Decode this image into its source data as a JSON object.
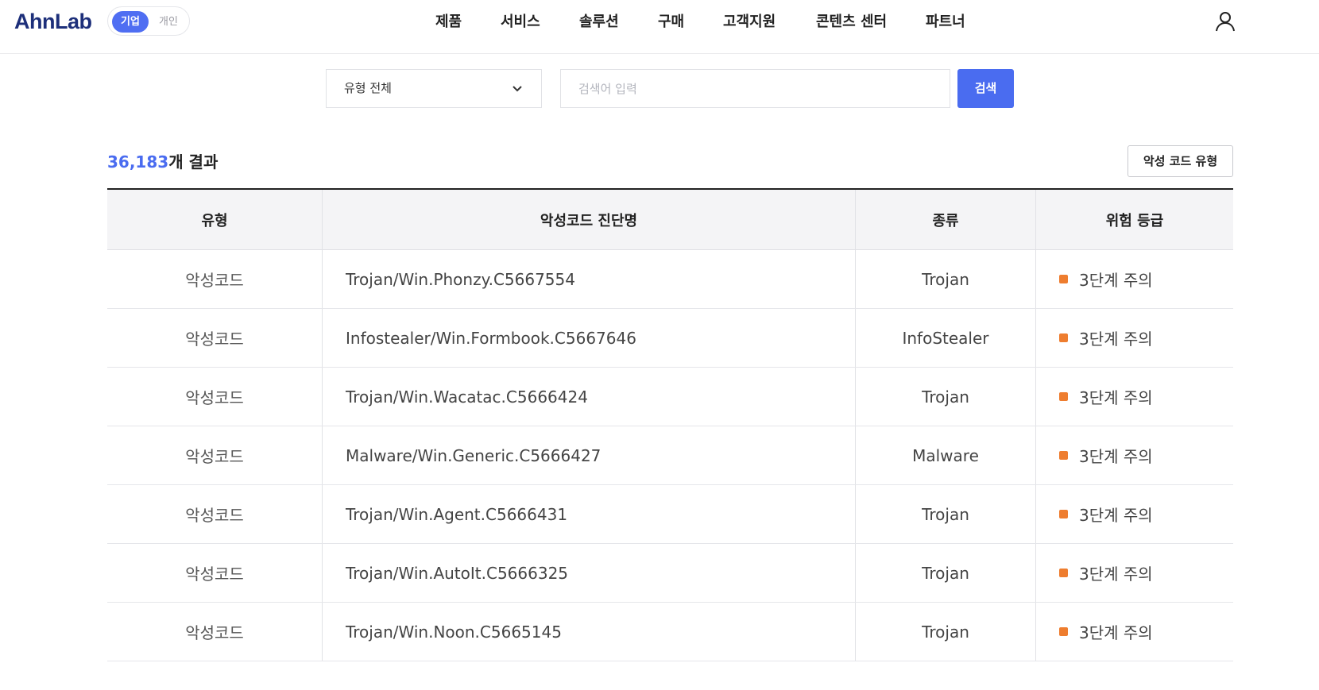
{
  "header": {
    "logo": "AhnLab",
    "toggle": {
      "active": "기업",
      "inactive": "개인"
    },
    "nav": [
      "제품",
      "서비스",
      "솔루션",
      "구매",
      "고객지원",
      "콘텐츠 센터",
      "파트너"
    ],
    "user_icon": "user-icon"
  },
  "filters": {
    "type_select": "유형 전체",
    "search_placeholder": "검색어 입력",
    "search_button": "검색"
  },
  "results": {
    "count": "36,183",
    "count_suffix": "개 결과",
    "type_button": "악성 코드 유형"
  },
  "table": {
    "headers": [
      "유형",
      "악성코드 진단명",
      "종류",
      "위험 등급"
    ],
    "risk_color": "#ee7d2f",
    "rows": [
      {
        "type": "악성코드",
        "name": "Trojan/Win.Phonzy.C5667554",
        "kind": "Trojan",
        "risk": "3단계 주의"
      },
      {
        "type": "악성코드",
        "name": "Infostealer/Win.Formbook.C5667646",
        "kind": "InfoStealer",
        "risk": "3단계 주의"
      },
      {
        "type": "악성코드",
        "name": "Trojan/Win.Wacatac.C5666424",
        "kind": "Trojan",
        "risk": "3단계 주의"
      },
      {
        "type": "악성코드",
        "name": "Malware/Win.Generic.C5666427",
        "kind": "Malware",
        "risk": "3단계 주의"
      },
      {
        "type": "악성코드",
        "name": "Trojan/Win.Agent.C5666431",
        "kind": "Trojan",
        "risk": "3단계 주의"
      },
      {
        "type": "악성코드",
        "name": "Trojan/Win.AutoIt.C5666325",
        "kind": "Trojan",
        "risk": "3단계 주의"
      },
      {
        "type": "악성코드",
        "name": "Trojan/Win.Noon.C5665145",
        "kind": "Trojan",
        "risk": "3단계 주의"
      }
    ]
  }
}
